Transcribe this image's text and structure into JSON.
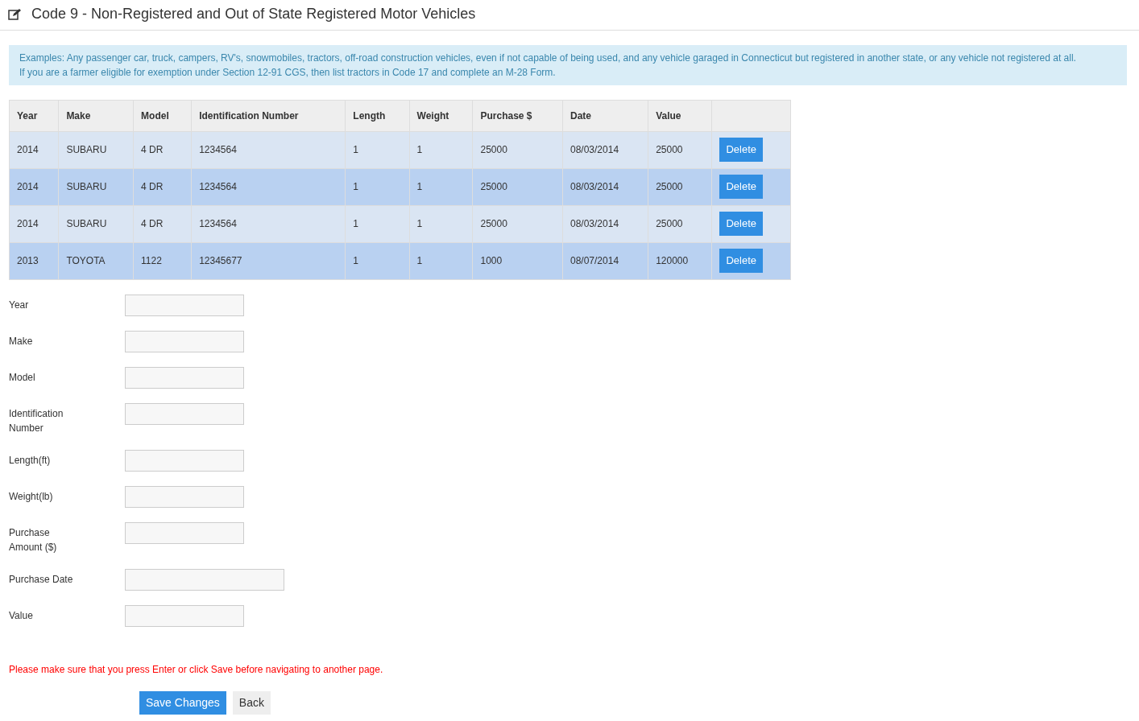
{
  "page_title": "Code 9 - Non-Registered and Out of State Registered Motor Vehicles",
  "info_lines": [
    "Examples: Any passenger car, truck, campers, RV's, snowmobiles, tractors, off-road construction vehicles, even if not capable of being used, and any vehicle garaged in Connecticut but registered in another state, or any vehicle not registered at all.",
    "If you are a farmer eligible for exemption under Section 12-91 CGS, then list tractors in Code 17 and complete an M-28 Form."
  ],
  "table": {
    "columns": [
      "Year",
      "Make",
      "Model",
      "Identification Number",
      "Length",
      "Weight",
      "Purchase $",
      "Date",
      "Value"
    ],
    "rows": [
      {
        "cells": [
          "2014",
          "SUBARU",
          "4 DR",
          "1234564",
          "1",
          "1",
          "25000",
          "08/03/2014",
          "25000"
        ],
        "action": "Delete"
      },
      {
        "cells": [
          "2014",
          "SUBARU",
          "4 DR",
          "1234564",
          "1",
          "1",
          "25000",
          "08/03/2014",
          "25000"
        ],
        "action": "Delete"
      },
      {
        "cells": [
          "2014",
          "SUBARU",
          "4 DR",
          "1234564",
          "1",
          "1",
          "25000",
          "08/03/2014",
          "25000"
        ],
        "action": "Delete"
      },
      {
        "cells": [
          "2013",
          "TOYOTA",
          "1122",
          "12345677",
          "1",
          "1",
          "1000",
          "08/07/2014",
          "120000"
        ],
        "action": "Delete"
      }
    ]
  },
  "form": {
    "fields": [
      {
        "label": "Year",
        "kind": "short"
      },
      {
        "label": "Make",
        "kind": "short"
      },
      {
        "label": "Model",
        "kind": "short"
      },
      {
        "label": "Identification Number",
        "kind": "short"
      },
      {
        "label": "Length(ft)",
        "kind": "short"
      },
      {
        "label": "Weight(lb)",
        "kind": "short"
      },
      {
        "label": "Purchase Amount ($)",
        "kind": "short"
      },
      {
        "label": "Purchase Date",
        "kind": "wide"
      },
      {
        "label": "Value",
        "kind": "short"
      }
    ]
  },
  "warning": "Please make sure that you press Enter or click Save before navigating to another page.",
  "buttons": [
    {
      "label": "Save Changes",
      "kind": "primary"
    },
    {
      "label": "Back",
      "kind": "secondary"
    }
  ]
}
